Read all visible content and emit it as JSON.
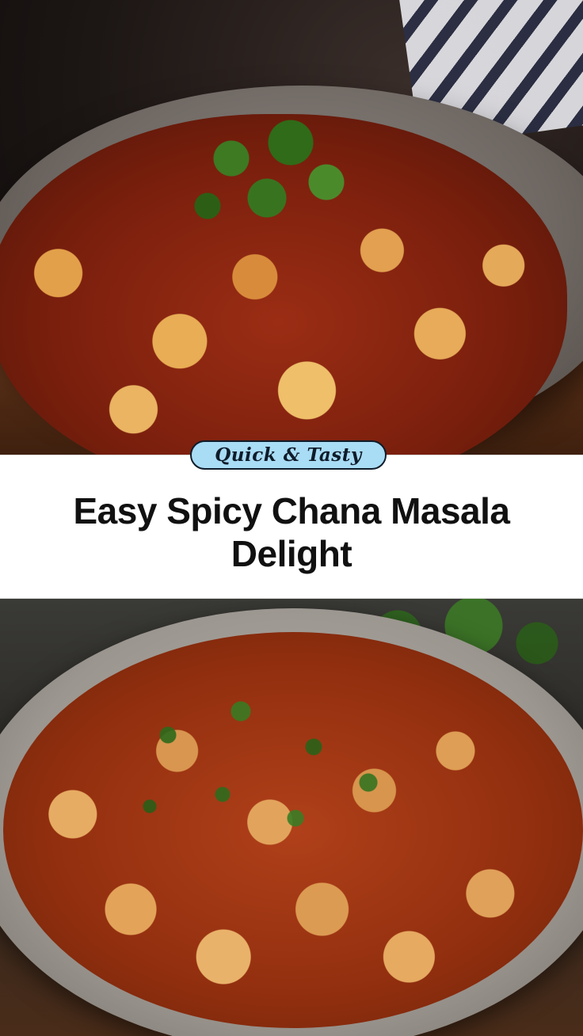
{
  "badge": {
    "label": "Quick & Tasty",
    "background_color": "#a9dcf5",
    "border_color": "#0f1c2a"
  },
  "title": {
    "text": "Easy Spicy Chana Masala Delight"
  },
  "images": {
    "top": "chana-masala-bowl-photo",
    "bottom": "chana-masala-closeup-photo"
  },
  "colors": {
    "title_text": "#111111",
    "band_background": "#ffffff"
  }
}
